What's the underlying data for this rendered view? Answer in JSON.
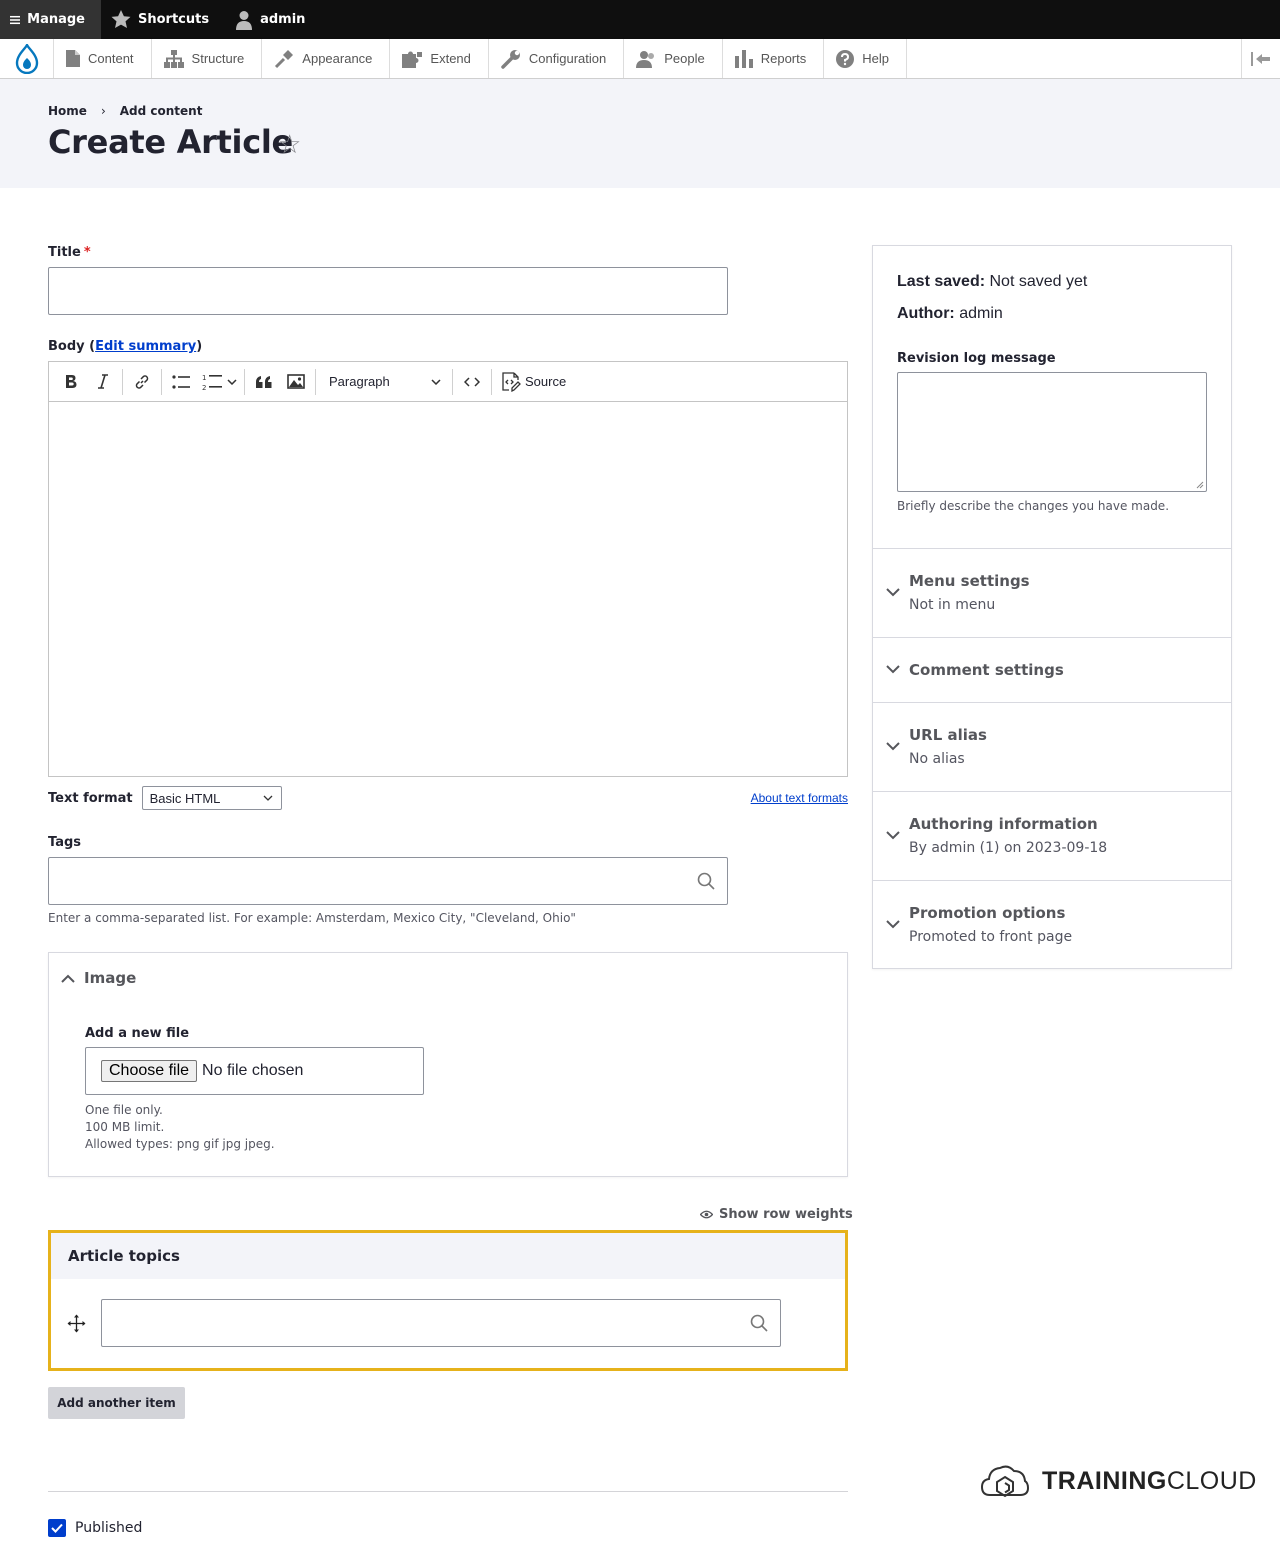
{
  "toolbar": {
    "manage": "Manage",
    "shortcuts": "Shortcuts",
    "user": "admin"
  },
  "menu": {
    "items": [
      {
        "label": "Content",
        "icon": "file-icon"
      },
      {
        "label": "Structure",
        "icon": "sitemap-icon"
      },
      {
        "label": "Appearance",
        "icon": "paintbrush-icon"
      },
      {
        "label": "Extend",
        "icon": "puzzle-icon"
      },
      {
        "label": "Configuration",
        "icon": "wrench-icon"
      },
      {
        "label": "People",
        "icon": "people-icon"
      },
      {
        "label": "Reports",
        "icon": "bar-chart-icon"
      },
      {
        "label": "Help",
        "icon": "help-icon"
      }
    ]
  },
  "breadcrumb": {
    "home": "Home",
    "sep": "›",
    "current": "Add content"
  },
  "page": {
    "title": "Create Article",
    "star": "☆"
  },
  "form": {
    "title_label": "Title",
    "required_mark": "*",
    "body_label_prefix": "Body (",
    "edit_summary": "Edit summary",
    "body_label_suffix": ")",
    "editor": {
      "heading_select": "Paragraph",
      "source_label": "Source"
    },
    "text_format_label": "Text format",
    "text_format_value": "Basic HTML",
    "about_text_formats": "About text formats",
    "tags_label": "Tags",
    "tags_desc": "Enter a comma-separated list. For example: Amsterdam, Mexico City, \"Cleveland, Ohio\"",
    "image": {
      "summary": "Image",
      "new_file_label": "Add a new file",
      "choose_button": "Choose file",
      "no_file": "No file chosen",
      "desc_1": "One file only.",
      "desc_2": "100 MB limit.",
      "desc_3": "Allowed types: png gif jpg jpeg."
    },
    "show_row_weights": "Show row weights",
    "article_topics": "Article topics",
    "add_another": "Add another item",
    "published": "Published"
  },
  "sidebar": {
    "last_saved_label": "Last saved:",
    "last_saved_value": "Not saved yet",
    "author_label": "Author:",
    "author_value": "admin",
    "revision_label": "Revision log message",
    "revision_desc": "Briefly describe the changes you have made.",
    "sections": [
      {
        "title": "Menu settings",
        "summary": "Not in menu"
      },
      {
        "title": "Comment settings",
        "summary": ""
      },
      {
        "title": "URL alias",
        "summary": "No alias"
      },
      {
        "title": "Authoring information",
        "summary": "By admin (1) on 2023-09-18"
      },
      {
        "title": "Promotion options",
        "summary": "Promoted to front page"
      }
    ]
  },
  "brand": {
    "bold": "TRAINING",
    "light": "CLOUD"
  },
  "colors": {
    "accent": "#003ecc",
    "highlight": "#e6b21b",
    "drupal_blue": "#0678be"
  }
}
